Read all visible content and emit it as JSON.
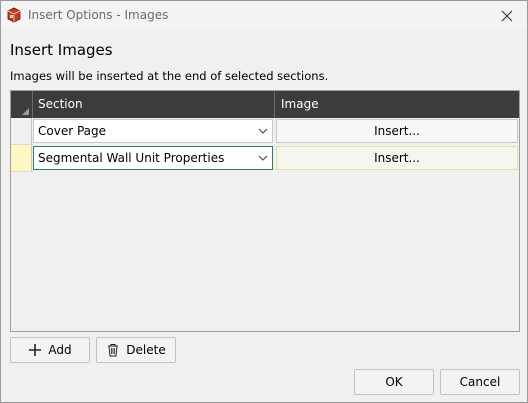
{
  "window": {
    "title": "Insert Options - Images",
    "close_glyph": "✕"
  },
  "heading": "Insert Images",
  "subtext": "Images will be inserted at the end of selected sections.",
  "table": {
    "columns": [
      "Section",
      "Image"
    ],
    "rows": [
      {
        "section": "Cover Page",
        "image_button": "Insert...",
        "current": false
      },
      {
        "section": "Segmental Wall Unit Properties",
        "image_button": "Insert...",
        "current": true
      }
    ]
  },
  "buttons": {
    "add": "Add",
    "delete": "Delete",
    "ok": "OK",
    "cancel": "Cancel"
  },
  "icons": {
    "app": "app-icon",
    "close": "close-icon",
    "chevron": "chevron-down-icon",
    "add": "plus-icon",
    "delete": "trash-icon"
  },
  "colors": {
    "header_bg": "#3c3c3c",
    "current_row_marker": "#fdf7c3",
    "focus_border": "#2e7d6b"
  }
}
